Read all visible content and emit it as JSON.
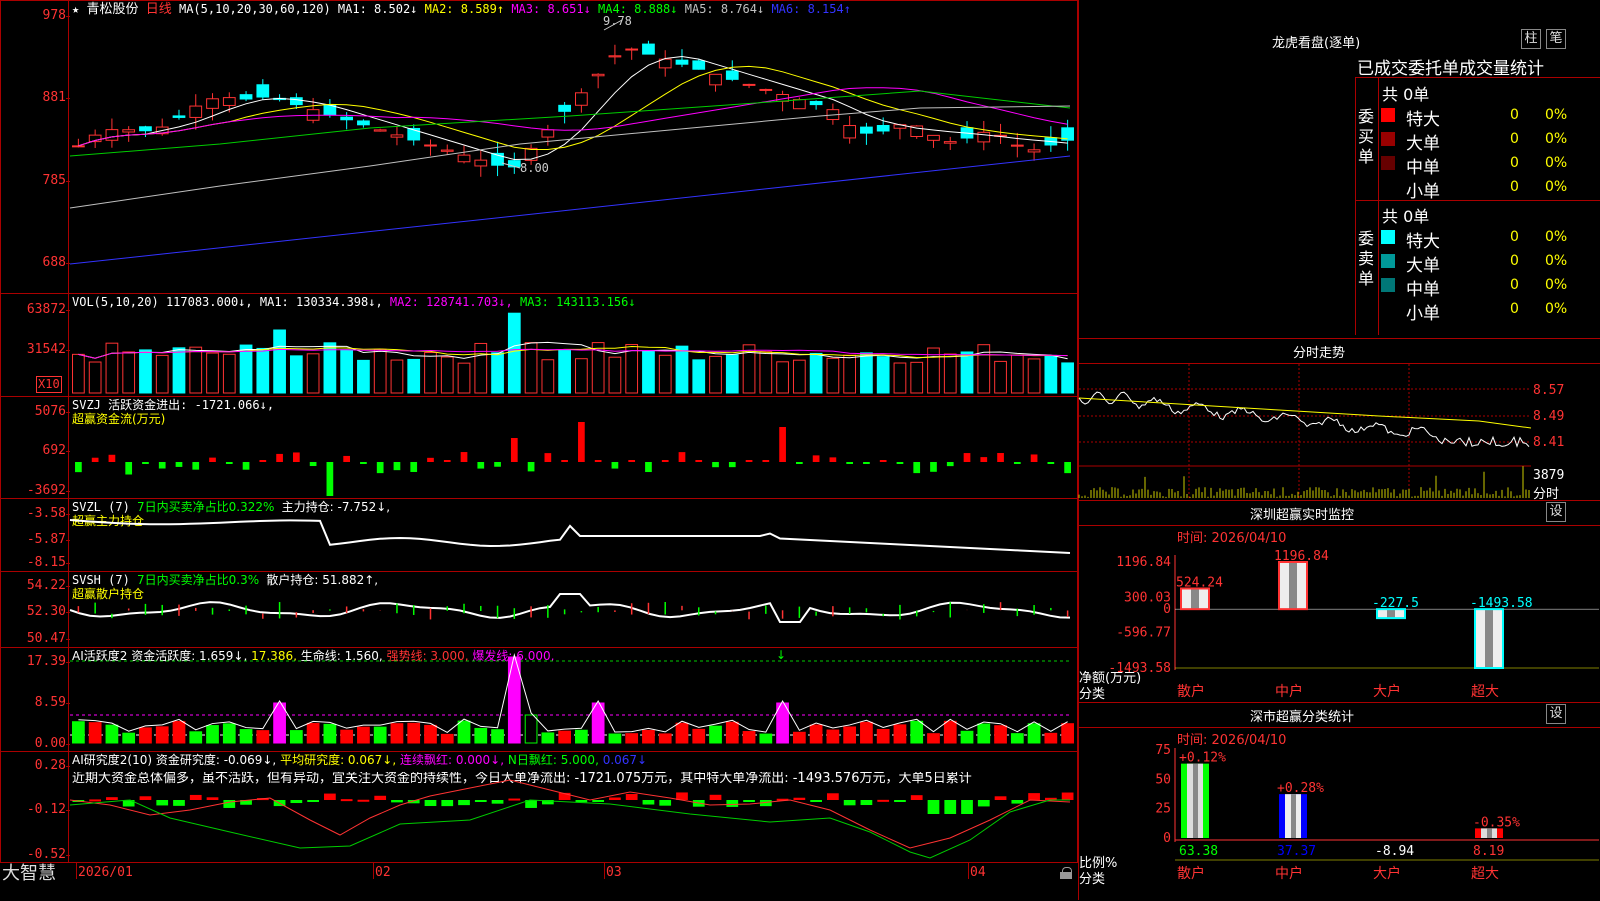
{
  "stock": {
    "star": "★",
    "name": "青松股份",
    "period": "日线"
  },
  "main": {
    "ma_spec": "MA(5,10,20,30,60,120)",
    "ma": [
      {
        "label": "MA1: 8.502↓",
        "color": "#ffffff"
      },
      {
        "label": "MA2: 8.589↑",
        "color": "#ffff00"
      },
      {
        "label": "MA3: 8.651↓",
        "color": "#ff00ff"
      },
      {
        "label": "MA4: 8.888↓",
        "color": "#00ff00"
      },
      {
        "label": "MA5: 8.764↓",
        "color": "#c0c0c0"
      },
      {
        "label": "MA6: 8.154↑",
        "color": "#3333ff"
      }
    ],
    "y_ticks": [
      "978",
      "881",
      "785",
      "688"
    ],
    "high_mark": "9.78",
    "low_mark": "8.00"
  },
  "vol": {
    "spec": "VOL(5,10,20)",
    "value": "117083.000↓,",
    "ma": [
      {
        "label": "MA1: 130334.398↓,",
        "color": "#ffffff"
      },
      {
        "label": "MA2: 128741.703↓,",
        "color": "#ff00ff"
      },
      {
        "label": "MA3: 143113.156↓",
        "color": "#00ff00"
      }
    ],
    "y_ticks": [
      "63872",
      "31542"
    ],
    "unit": "X10"
  },
  "svzj": {
    "line1": "SVZJ  活跃资金进出: -1721.066↓,",
    "line2": "超赢资金流(万元)",
    "y_ticks": [
      "5076",
      "692",
      "-3692"
    ]
  },
  "svzl": {
    "name": "SVZL (7)",
    "part1": "7日内买卖净占比0.322%",
    "part2": "主力持仓: -7.752↓,",
    "line2": "超赢主力持仓",
    "y_ticks": [
      "-3.58",
      "-5.87",
      "-8.15"
    ]
  },
  "svsh": {
    "name": "SVSH (7)",
    "part1": "7日内买卖净占比0.3%",
    "part2": "散户持仓: 51.882↑,",
    "line2": "超赢散户持仓",
    "y_ticks": [
      "54.22",
      "52.30",
      "50.47"
    ]
  },
  "ai_active": {
    "parts": [
      {
        "t": "AI活跃度2 资金活跃度: 1.659↓,",
        "color": "#ffffff"
      },
      {
        "t": "17.386,",
        "color": "#ffff00"
      },
      {
        "t": "生命线: 1.560,",
        "color": "#ffffff"
      },
      {
        "t": "强势线: 3.000,",
        "color": "#ff3333"
      },
      {
        "t": "爆发线: 6.000,",
        "color": "#ff00ff"
      }
    ],
    "y_ticks": [
      "17.39",
      "8.59",
      "0.00"
    ]
  },
  "ai_research": {
    "parts": [
      {
        "t": "AI研究度2(10) 资金研究度: -0.069↓,",
        "color": "#ffffff"
      },
      {
        "t": "平均研究度: 0.067↓,",
        "color": "#ffff00"
      },
      {
        "t": "连续飘红: 0.000↓,",
        "color": "#ff00ff"
      },
      {
        "t": "N日飘红: 5.000,",
        "color": "#00ff00"
      },
      {
        "t": "0.067↓",
        "color": "#3333ff"
      }
    ],
    "comment": "近期大资金总体偏多，虽不活跃，但有异动，宜关注大资金的持续性，今日大单净流出: -1721.075万元，其中特大单净流出: -1493.576万元，大单5日累计",
    "y_ticks": [
      "0.28",
      "-0.12",
      "-0.52"
    ]
  },
  "dates": [
    "2026/01",
    "02",
    "03",
    "04"
  ],
  "brand": "大智慧",
  "dragon": {
    "title": "龙虎看盘(逐单)",
    "btn_bar": "柱",
    "btn_pen": "笔",
    "tabs": [
      "已成交",
      "委托单",
      "成交量",
      "统计"
    ],
    "buy": {
      "side": "委买单",
      "total": "共 0单",
      "rows": [
        {
          "label": "特大",
          "value": "0",
          "pct": "0%",
          "color": "#ff0000"
        },
        {
          "label": "大单",
          "value": "0",
          "pct": "0%",
          "color": "#990000"
        },
        {
          "label": "中单",
          "value": "0",
          "pct": "0%",
          "color": "#660000"
        },
        {
          "label": "小单",
          "value": "0",
          "pct": "0%",
          "color": ""
        }
      ]
    },
    "sell": {
      "side": "委卖单",
      "total": "共 0单",
      "rows": [
        {
          "label": "特大",
          "value": "0",
          "pct": "0%",
          "color": "#00ffff"
        },
        {
          "label": "大单",
          "value": "0",
          "pct": "0%",
          "color": "#009999"
        },
        {
          "label": "中单",
          "value": "0",
          "pct": "0%",
          "color": "#007777"
        },
        {
          "label": "小单",
          "value": "0",
          "pct": "0%",
          "color": ""
        }
      ]
    }
  },
  "intraday": {
    "title": "分时走势",
    "price_ticks": [
      "8.57",
      "8.49",
      "8.41"
    ],
    "vol_tick": "3879",
    "vol_label": "分时"
  },
  "monitor": {
    "title": "深圳超赢实时监控",
    "set_btn": "设",
    "time": "时间: 2026/04/10",
    "y_ticks": [
      "1196.84",
      "300.03",
      "0",
      "-596.77",
      "-1493.58"
    ],
    "ylabel": "净额(万元)",
    "xlabel": "分类",
    "cats": [
      "散户",
      "中户",
      "大户",
      "超大"
    ],
    "values": [
      524.24,
      1196.84,
      -227.5,
      -1493.58
    ],
    "value_labels": [
      "524.24",
      "1196.84",
      "-227.5",
      "-1493.58"
    ]
  },
  "classify": {
    "title": "深市超赢分类统计",
    "set_btn": "设",
    "time": "时间: 2026/04/10",
    "y_ticks": [
      "75",
      "50",
      "25",
      "0"
    ],
    "ylabel": "比例%",
    "xlabel": "分类",
    "cats": [
      "散户",
      "中户",
      "大户",
      "超大"
    ],
    "pct_labels": [
      "+0.12%",
      "+0.28%",
      "",
      "-0.35%"
    ],
    "values": [
      63.38,
      37.37,
      -8.94,
      8.19
    ],
    "value_labels": [
      "63.38",
      "37.37",
      "-8.94",
      "8.19"
    ]
  },
  "chart_data": {
    "type": "bar",
    "title": "深圳超赢实时监控",
    "categories": [
      "散户",
      "中户",
      "大户",
      "超大"
    ],
    "series": [
      {
        "name": "净额(万元)",
        "values": [
          524.24,
          1196.84,
          -227.5,
          -1493.58
        ]
      },
      {
        "name": "比例%",
        "values": [
          63.38,
          37.37,
          -8.94,
          8.19
        ]
      }
    ]
  }
}
